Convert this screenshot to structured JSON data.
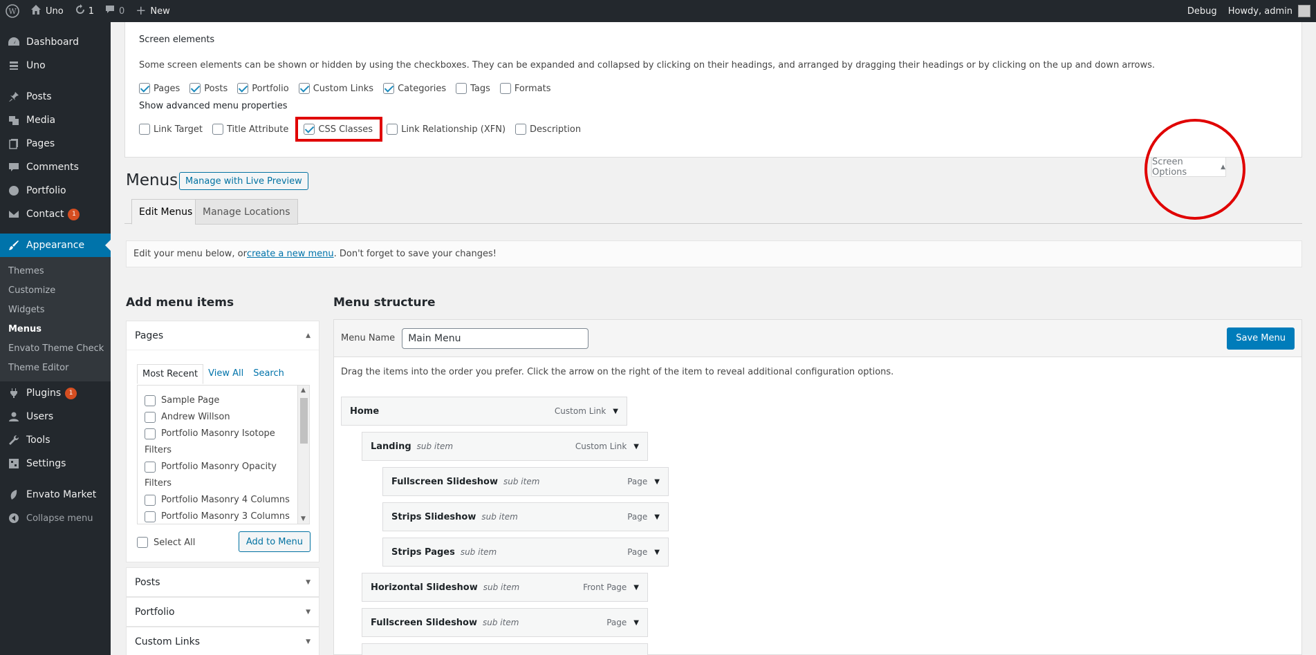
{
  "adminbar": {
    "site_name": "Uno",
    "updates_count": "1",
    "comments_count": "0",
    "new_label": "New",
    "debug_label": "Debug",
    "howdy_label": "Howdy, admin"
  },
  "sidebar": {
    "items": [
      {
        "label": "Dashboard",
        "icon": "dashboard-icon"
      },
      {
        "label": "Uno",
        "icon": "uno-icon"
      },
      {
        "label": "Posts",
        "icon": "pin-icon"
      },
      {
        "label": "Media",
        "icon": "media-icon"
      },
      {
        "label": "Pages",
        "icon": "pages-icon"
      },
      {
        "label": "Comments",
        "icon": "comment-icon"
      },
      {
        "label": "Portfolio",
        "icon": "portfolio-icon"
      },
      {
        "label": "Contact",
        "icon": "mail-icon",
        "badge": "1"
      },
      {
        "label": "Appearance",
        "icon": "paintbrush-icon"
      },
      {
        "label": "Plugins",
        "icon": "plugin-icon",
        "badge": "1"
      },
      {
        "label": "Users",
        "icon": "user-icon"
      },
      {
        "label": "Tools",
        "icon": "wrench-icon"
      },
      {
        "label": "Settings",
        "icon": "settings-icon"
      },
      {
        "label": "Envato Market",
        "icon": "leaf-icon"
      },
      {
        "label": "Collapse menu",
        "icon": "collapse-icon"
      }
    ],
    "appearance_sub": [
      "Themes",
      "Customize",
      "Widgets",
      "Menus",
      "Envato Theme Check",
      "Theme Editor"
    ]
  },
  "screen_options": {
    "title": "Screen elements",
    "description": "Some screen elements can be shown or hidden by using the checkboxes. They can be expanded and collapsed by clicking on their headings, and arranged by dragging their headings or by clicking on the up and down arrows.",
    "elements": [
      {
        "label": "Pages",
        "checked": true
      },
      {
        "label": "Posts",
        "checked": true
      },
      {
        "label": "Portfolio",
        "checked": true
      },
      {
        "label": "Custom Links",
        "checked": true
      },
      {
        "label": "Categories",
        "checked": true
      },
      {
        "label": "Tags",
        "checked": false
      },
      {
        "label": "Formats",
        "checked": false
      }
    ],
    "advanced_title": "Show advanced menu properties",
    "advanced": [
      {
        "label": "Link Target",
        "checked": false
      },
      {
        "label": "Title Attribute",
        "checked": false
      },
      {
        "label": "CSS Classes",
        "checked": true
      },
      {
        "label": "Link Relationship (XFN)",
        "checked": false
      },
      {
        "label": "Description",
        "checked": false
      }
    ],
    "tab_label": "Screen Options"
  },
  "header": {
    "title": "Menus",
    "live_preview": "Manage with Live Preview"
  },
  "tabs": [
    "Edit Menus",
    "Manage Locations"
  ],
  "notice": {
    "before": "Edit your menu below, or ",
    "link": "create a new menu",
    "after": ". Don't forget to save your changes!"
  },
  "add_items": {
    "title": "Add menu items",
    "pages_label": "Pages",
    "inner_tabs": [
      "Most Recent",
      "View All",
      "Search"
    ],
    "pages": [
      "Sample Page",
      "Andrew Willson",
      "Portfolio Masonry Isotope",
      "Filters",
      "Portfolio Masonry Opacity",
      "Filters",
      "Portfolio Masonry 4 Columns",
      "Portfolio Masonry 3 Columns"
    ],
    "select_all": "Select All",
    "add_button": "Add to Menu",
    "other_sections": [
      "Posts",
      "Portfolio",
      "Custom Links"
    ]
  },
  "structure": {
    "title": "Menu structure",
    "name_label": "Menu Name",
    "name_value": "Main Menu",
    "save_label": "Save Menu",
    "hint": "Drag the items into the order you prefer. Click the arrow on the right of the item to reveal additional configuration options.",
    "items": [
      {
        "title": "Home",
        "sub": "",
        "type": "Custom Link"
      },
      {
        "title": "Landing",
        "sub": "sub item",
        "type": "Custom Link"
      },
      {
        "title": "Fullscreen Slideshow",
        "sub": "sub item",
        "type": "Page"
      },
      {
        "title": "Strips Slideshow",
        "sub": "sub item",
        "type": "Page"
      },
      {
        "title": "Strips Pages",
        "sub": "sub item",
        "type": "Page"
      },
      {
        "title": "Horizontal Slideshow",
        "sub": "sub item",
        "type": "Front Page"
      },
      {
        "title": "Fullscreen Slideshow",
        "sub": "sub item",
        "type": "Page"
      }
    ]
  }
}
